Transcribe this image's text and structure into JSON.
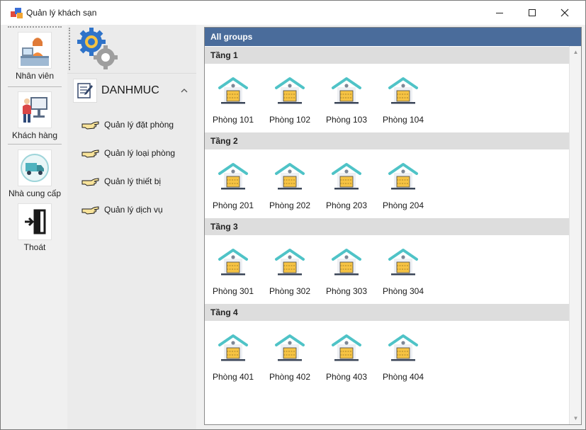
{
  "window": {
    "title": "Quản lý khách sạn"
  },
  "nav": {
    "items": [
      {
        "label": "Nhân viên",
        "icon": "receptionist-icon"
      },
      {
        "label": "Khách hàng",
        "icon": "customer-icon"
      },
      {
        "label": "Nhà cung cấp",
        "icon": "supplier-truck-icon"
      },
      {
        "label": "Thoát",
        "icon": "exit-door-icon"
      }
    ]
  },
  "category": {
    "title": "DANHMUC",
    "items": [
      {
        "label": "Quản lý đặt phòng"
      },
      {
        "label": "Quản lý loại phòng"
      },
      {
        "label": "Quản lý thiết bị"
      },
      {
        "label": "Quản lý dịch vụ"
      }
    ]
  },
  "gallery": {
    "header": "All groups",
    "groups": [
      {
        "title": "Tầng 1",
        "rooms": [
          "Phòng 101",
          "Phòng 102",
          "Phòng 103",
          "Phòng 104"
        ]
      },
      {
        "title": "Tầng 2",
        "rooms": [
          "Phòng 201",
          "Phòng 202",
          "Phòng 203",
          "Phòng 204"
        ]
      },
      {
        "title": "Tầng 3",
        "rooms": [
          "Phòng 301",
          "Phòng 302",
          "Phòng 303",
          "Phòng 304"
        ]
      },
      {
        "title": "Tầng 4",
        "rooms": [
          "Phòng 401",
          "Phòng 402",
          "Phòng 403",
          "Phòng 404"
        ]
      }
    ]
  },
  "colors": {
    "gallery_header": "#4a6c9b",
    "group_header": "#dddddd",
    "roof": "#4fc3c7",
    "house_body": "#f6c343",
    "gear_blue": "#2f73c9",
    "gear_gray": "#9e9e9e"
  }
}
